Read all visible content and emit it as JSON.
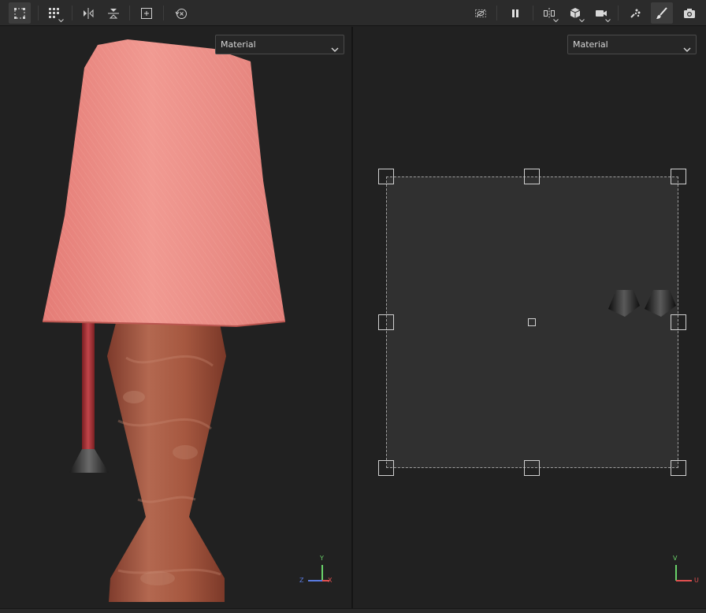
{
  "toolbar": {
    "left_tools": [
      {
        "name": "selection-mode-icon",
        "active": true
      },
      {
        "name": "grid-options-icon"
      },
      {
        "name": "mirror-horizontal-icon"
      },
      {
        "name": "mirror-vertical-icon"
      },
      {
        "name": "frame-selection-icon"
      },
      {
        "name": "reset-transform-icon"
      }
    ],
    "right_tools": [
      {
        "name": "hide-icon"
      },
      {
        "name": "pause-icon"
      },
      {
        "name": "symmetry-icon"
      },
      {
        "name": "cube-icon"
      },
      {
        "name": "camera-icon"
      },
      {
        "name": "scatter-icon"
      },
      {
        "name": "brush-icon",
        "active": true
      },
      {
        "name": "screenshot-icon"
      }
    ]
  },
  "left_viewport": {
    "mode_label": "Material",
    "axes": {
      "y": "Y",
      "z": "Z",
      "x": "X"
    }
  },
  "right_viewport": {
    "mode_label": "Material",
    "axes": {
      "v": "V",
      "u": "U"
    }
  },
  "colors": {
    "accent": "#3d3d3d",
    "axis_x": "#e05050",
    "axis_y": "#6ad36a",
    "axis_z": "#5a7be0",
    "shade_pink": "#ea8a84",
    "base_terracotta": "#a3553f"
  }
}
